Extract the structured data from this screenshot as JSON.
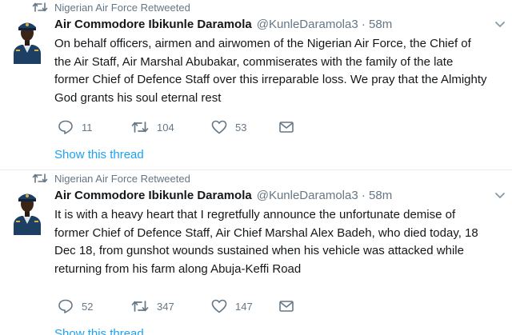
{
  "tweets": [
    {
      "retweet_context": "Nigerian Air Force Retweeted",
      "author_name": "Air Commodore Ibikunle Daramola",
      "author_handle": "@KunleDaramola3 · 58m",
      "text": "On behalf officers, airmen and airwomen of the Nigerian Air Force, the Chief of\nthe Air Staff, Air Marshal Abubakar, commiserates with the family of the late\nformer Chief of Defence Staff over this irreparable loss. We pray that the Almighty\nGod grants his soul eternal rest",
      "replies": "11",
      "retweets": "104",
      "likes": "53",
      "thread_link": "Show this thread"
    },
    {
      "retweet_context": "Nigerian Air Force Retweeted",
      "author_name": "Air Commodore Ibikunle Daramola",
      "author_handle": "@KunleDaramola3 · 58m",
      "text": "It is with a heavy heart that I regretfully announce the unfortunate demise of\nformer Chief of Defence Staff, Air Chief Marshal Alex Badeh, who died today, 18\nDec 18, from gunshot wounds sustained when his vehicle was attacked while\nreturning from his farm along Abuja-Keffi Road",
      "replies": "52",
      "retweets": "347",
      "likes": "147",
      "thread_link": "Show this thread"
    }
  ],
  "colors": {
    "text": "#14171a",
    "secondary": "#657786",
    "link": "#1da1f2",
    "divider": "#e6ecf0"
  },
  "icons": [
    "retweet-icon",
    "reply-icon",
    "like-icon",
    "dm-icon",
    "caret-down-icon"
  ]
}
